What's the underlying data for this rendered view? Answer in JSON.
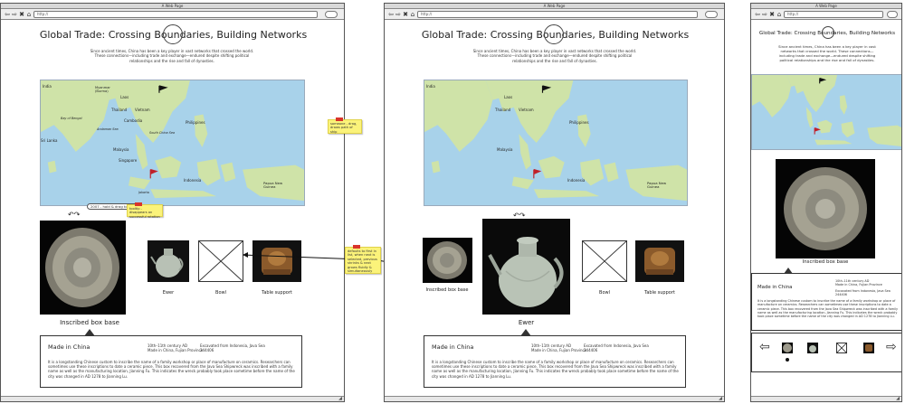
{
  "browser": {
    "window_title": "A Web Page",
    "url": "http://",
    "nav_icons": [
      "back-icon",
      "forward-icon",
      "close-icon",
      "home-icon"
    ]
  },
  "page": {
    "title": "Global Trade: Crossing Boundaries, Building Networks",
    "intro": "Since ancient times, China has been a key player in vast networks that crossed the world. These connections—including trade and exchange—endured despite shifting political relationships and the rise and fall of dynasties."
  },
  "map": {
    "labels": {
      "india": "India",
      "myanmar": "Myanmar (Burma)",
      "laos": "Laos",
      "thailand": "Thailand",
      "vietnam": "Vietnam",
      "cambodia": "Cambodia",
      "philippines": "Philippines",
      "bay_of_bengal": "Bay of Bengal",
      "andaman_sea": "Andaman Sea",
      "south_china_sea": "South China Sea",
      "sri_lanka": "Sri Lanka",
      "malaysia": "Malaysia",
      "singapore": "Singapore",
      "indonesia": "Indonesia",
      "papua": "Papua New Guinea",
      "jakarta": "Jakarta"
    }
  },
  "objects": {
    "inscribed": "Inscribed box base",
    "ewer": "Ewer",
    "bowl": "Bowl",
    "table": "Table support"
  },
  "detail": {
    "title": "Made in China",
    "meta_date": "10th–11th century AD",
    "meta_place": "Made in China, Fujian Province",
    "meta_excavated": "Excavated from Indonesia, Java Sea",
    "meta_number": "244406",
    "body": "It is a longstanding Chinese custom to inscribe the name of a family workshop or place of manufacture on ceramics. Researchers can sometimes use these inscriptions to date a ceramic piece. This box recovered from the Java Sea Shipwreck was inscribed with a family name as well as the manufacturing location, Jianning Fu. This indicates the wreck probably took place sometime before the name of the city was changed in AD 1278 to Jianning Lu."
  },
  "annotations": {
    "note_map": "someone - drag, draws path of ship",
    "note_tooltip": "tooltip - disappears on successful rotation",
    "note_default": "defaults to first in list, when next is selected, previous shrinks & next grows fluidly & simultaneously",
    "callout": "2007 - hold & drag to rotate",
    "rotate_glyph": "↶↷"
  },
  "colors": {
    "sea": "#a8d2ea",
    "land": "#cfe3a8",
    "sticky": "#fbf37a",
    "pin": "#d9342b",
    "flag": "#c0202a"
  }
}
